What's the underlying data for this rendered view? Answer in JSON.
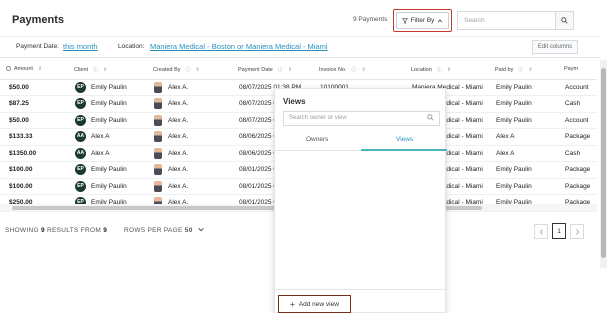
{
  "header": {
    "title": "Payments",
    "count_text": "9 Payments",
    "filter_label": "Filter By",
    "search_placeholder": "Search"
  },
  "subbar": {
    "payment_date_label": "Payment Date:",
    "payment_date_value": "this month",
    "location_label": "Location:",
    "location_value": "Maniera Medical - Boston or Maniera Medical - Miami",
    "edit_columns_label": "Edit columns"
  },
  "table": {
    "columns": [
      "Amount",
      "Client",
      "Created By",
      "Payment Date",
      "Invoice No.",
      "Location",
      "Paid by",
      "Paym"
    ],
    "rows": [
      {
        "amount": "$50.00",
        "client_initials": "EP",
        "client": "Emily Paulin",
        "created_by": "Alex A.",
        "date": "08/07/2025 01:38 PM",
        "invoice": "10100001",
        "location": "Maniera Medical - Miami",
        "paid_by": "Emily Paulin",
        "method": "Account"
      },
      {
        "amount": "$87.25",
        "client_initials": "EP",
        "client": "Emily Paulin",
        "created_by": "Alex A.",
        "date": "08/07/2025 01:25 PM",
        "invoice": "",
        "location": "Maniera Medical - Miami",
        "paid_by": "Emily Paulin",
        "method": "Cash"
      },
      {
        "amount": "$50.00",
        "client_initials": "EP",
        "client": "Emily Paulin",
        "created_by": "Alex A.",
        "date": "08/07/2025 01:20 PM",
        "invoice": "",
        "location": "Maniera Medical - Miami",
        "paid_by": "Emily Paulin",
        "method": "Account"
      },
      {
        "amount": "$133.33",
        "client_initials": "AA",
        "client": "Alex A",
        "created_by": "Alex A.",
        "date": "08/06/2025 04:10 PM",
        "invoice": "",
        "location": "Maniera Medical - Miami",
        "paid_by": "Alex A",
        "method": "Package"
      },
      {
        "amount": "$1350.00",
        "client_initials": "AA",
        "client": "Alex A",
        "created_by": "Alex A.",
        "date": "08/06/2025 03:02 PM",
        "invoice": "",
        "location": "Maniera Medical - Miami",
        "paid_by": "Alex A",
        "method": "Cash"
      },
      {
        "amount": "$100.00",
        "client_initials": "EP",
        "client": "Emily Paulin",
        "created_by": "Alex A.",
        "date": "08/01/2025 02:11 PM",
        "invoice": "",
        "location": "Maniera Medical - Miami",
        "paid_by": "Emily Paulin",
        "method": "Package"
      },
      {
        "amount": "$100.00",
        "client_initials": "EP",
        "client": "Emily Paulin",
        "created_by": "Alex A.",
        "date": "08/01/2025 02:05 PM",
        "invoice": "",
        "location": "Maniera Medical - Miami",
        "paid_by": "Emily Paulin",
        "method": "Package"
      },
      {
        "amount": "$250.00",
        "client_initials": "EP",
        "client": "Emily Paulin",
        "created_by": "Alex A.",
        "date": "08/01/2025 01:50 PM",
        "invoice": "",
        "location": "Maniera Medical - Miami",
        "paid_by": "Emily Paulin",
        "method": "Package"
      }
    ]
  },
  "footer": {
    "showing_prefix": "SHOWING",
    "showing_count": "9",
    "showing_mid": "RESULTS FROM",
    "showing_total": "9",
    "rows_per_page_label": "ROWS PER PAGE",
    "rows_per_page_value": "50",
    "current_page": "1"
  },
  "views_popup": {
    "title": "Views",
    "search_placeholder": "Search owner or view",
    "tab_owners": "Owners",
    "tab_views": "Views",
    "add_view_label": "Add new view"
  },
  "colors": {
    "link": "#2a8fbf",
    "highlight_border": "#c0392b",
    "tab_underline": "#49b6c0",
    "avatar_bg": "#1c3a2a"
  }
}
